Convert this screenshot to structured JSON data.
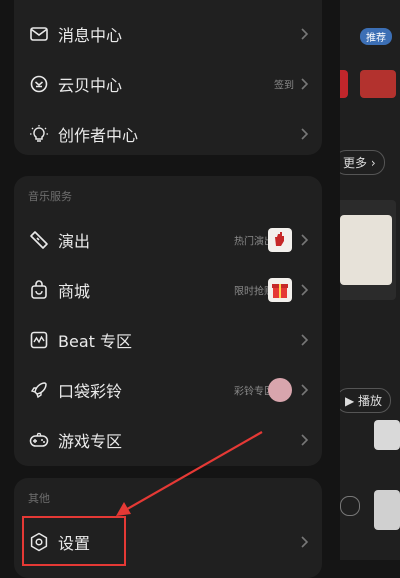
{
  "top_section": {
    "items": [
      {
        "label": "消息中心",
        "icon": "mail-icon",
        "sub": ""
      },
      {
        "label": "云贝中心",
        "icon": "coin-icon",
        "sub": "签到"
      },
      {
        "label": "创作者中心",
        "icon": "bulb-icon",
        "sub": ""
      }
    ]
  },
  "music_services": {
    "title": "音乐服务",
    "items": [
      {
        "label": "演出",
        "icon": "ticket-icon",
        "sub": "热门演出"
      },
      {
        "label": "商城",
        "icon": "bag-icon",
        "sub": "限时抢购"
      },
      {
        "label": "Beat 专区",
        "icon": "wave-icon",
        "sub": ""
      },
      {
        "label": "口袋彩铃",
        "icon": "rocket-icon",
        "sub": "彩铃专区"
      },
      {
        "label": "游戏专区",
        "icon": "gamepad-icon",
        "sub": ""
      }
    ]
  },
  "other": {
    "title": "其他",
    "items": [
      {
        "label": "设置",
        "icon": "settings-icon"
      }
    ]
  },
  "background": {
    "more_label": "更多",
    "play_label": "播放",
    "badge_text": "推荐"
  },
  "colors": {
    "highlight": "#e53935",
    "card": "#202020",
    "drawer": "#141414"
  }
}
